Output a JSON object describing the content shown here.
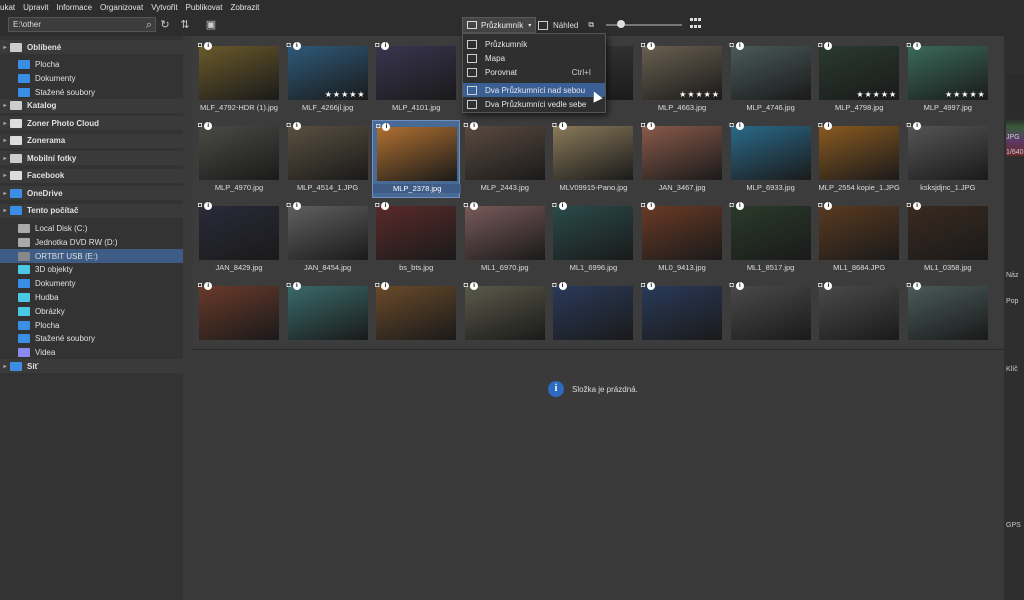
{
  "menubar": [
    "ukat",
    "Upravit",
    "Informace",
    "Organizovat",
    "Vytvořit",
    "Publikovat",
    "Zobrazit"
  ],
  "toolbar": {
    "path_value": "E:\\other",
    "view_label": "Průzkumník",
    "preview_label": "Náhled",
    "zoom_fraction": 0.2
  },
  "sidebar": {
    "items": [
      {
        "label": "Oblíbené",
        "section": true
      },
      {
        "label": "Plocha"
      },
      {
        "label": "Dokumenty"
      },
      {
        "label": "Stažené soubory"
      },
      {
        "label": "Katalog",
        "section": true
      },
      {
        "label": "Zoner Photo Cloud",
        "section": true
      },
      {
        "label": "Zonerama",
        "section": true
      },
      {
        "label": "Mobilní fotky",
        "section": true
      },
      {
        "label": "Facebook",
        "section": true
      },
      {
        "label": "OneDrive",
        "section": true
      },
      {
        "label": "Tento počítač",
        "section": true
      },
      {
        "label": "Local Disk (C:)"
      },
      {
        "label": "Jednotka DVD RW (D:)"
      },
      {
        "label": "ORTBIT USB (E:)",
        "selected": true
      },
      {
        "label": "3D objekty"
      },
      {
        "label": "Dokumenty"
      },
      {
        "label": "Hudba"
      },
      {
        "label": "Obrázky"
      },
      {
        "label": "Plocha"
      },
      {
        "label": "Stažené soubory"
      },
      {
        "label": "Videa"
      },
      {
        "label": "Síť",
        "section": true
      }
    ]
  },
  "dropdown": {
    "items": [
      {
        "label": "Průzkumník",
        "shortcut": ""
      },
      {
        "label": "Mapa",
        "shortcut": ""
      },
      {
        "label": "Porovnat",
        "shortcut": "Ctrl+I"
      },
      {
        "label": "Dva Průzkumníci nad sebou",
        "shortcut": "",
        "highlight": true
      },
      {
        "label": "Dva Průzkumníci vedle sebe",
        "shortcut": ""
      }
    ]
  },
  "files": [
    {
      "name": "MLF_4792-HDR (1).jpg",
      "color": "#6a5a2a",
      "stars": ""
    },
    {
      "name": "MLF_4266jl.jpg",
      "color": "#2e5a7a",
      "stars": "★★★★★"
    },
    {
      "name": "MLP_4101.jpg",
      "color": "#3a3550",
      "stars": ""
    },
    {
      "name": "",
      "color": "#3a3a3a",
      "stars": ""
    },
    {
      "name": "",
      "color": "#3a3a3a",
      "stars": ""
    },
    {
      "name": "MLP_4663.jpg",
      "color": "#6a6050",
      "stars": "★★★★★"
    },
    {
      "name": "MLP_4746.jpg",
      "color": "#4a5a5a",
      "stars": ""
    },
    {
      "name": "MLP_4798.jpg",
      "color": "#2a3a30",
      "stars": "★★★★★"
    },
    {
      "name": "MLP_4997.jpg",
      "color": "#3a6a5a",
      "stars": "★★★★★"
    },
    {
      "name": "MLP_4970.jpg",
      "color": "#4a4a45",
      "stars": ""
    },
    {
      "name": "MLP_4514_1.JPG",
      "color": "#5a5040",
      "stars": ""
    },
    {
      "name": "MLP_2378.jpg",
      "color": "#b07030",
      "stars": "",
      "selected": true
    },
    {
      "name": "MLP_2443.jpg",
      "color": "#5a4a40",
      "stars": ""
    },
    {
      "name": "MLV09915-Pano.jpg",
      "color": "#8a7a5a",
      "stars": ""
    },
    {
      "name": "JAN_3467.jpg",
      "color": "#8a5a4a",
      "stars": ""
    },
    {
      "name": "MLP_6933.jpg",
      "color": "#2a6a8a",
      "stars": ""
    },
    {
      "name": "MLP_2554 kopie_1.JPG",
      "color": "#8a5a20",
      "stars": ""
    },
    {
      "name": "ksksjdjnc_1.JPG",
      "color": "#555555",
      "stars": ""
    },
    {
      "name": "JAN_8429.jpg",
      "color": "#2a2a3a",
      "stars": ""
    },
    {
      "name": "JAN_8454.jpg",
      "color": "#606060",
      "stars": ""
    },
    {
      "name": "bs_bts.jpg",
      "color": "#5a2a2a",
      "stars": ""
    },
    {
      "name": "ML1_6970.jpg",
      "color": "#7a5a5a",
      "stars": ""
    },
    {
      "name": "ML1_6996.jpg",
      "color": "#2a4a4a",
      "stars": ""
    },
    {
      "name": "ML0_9413.jpg",
      "color": "#6a3a25",
      "stars": ""
    },
    {
      "name": "ML1_8517.jpg",
      "color": "#2a3a2a",
      "stars": ""
    },
    {
      "name": "ML1_8684.JPG",
      "color": "#5a3a20",
      "stars": ""
    },
    {
      "name": "ML1_0358.jpg",
      "color": "#3a2a20",
      "stars": ""
    },
    {
      "name": "",
      "color": "#6a3a2a",
      "stars": ""
    },
    {
      "name": "",
      "color": "#3a6a6a",
      "stars": ""
    },
    {
      "name": "",
      "color": "#6a4a2a",
      "stars": ""
    },
    {
      "name": "",
      "color": "#5a5a4a",
      "stars": ""
    },
    {
      "name": "",
      "color": "#2a3a5a",
      "stars": ""
    },
    {
      "name": "",
      "color": "#2a3a5a",
      "stars": ""
    },
    {
      "name": "",
      "color": "#4a4a4a",
      "stars": ""
    },
    {
      "name": "",
      "color": "#4a4a4a",
      "stars": ""
    },
    {
      "name": "",
      "color": "#4a5a5a",
      "stars": ""
    }
  ],
  "empty_message": "Složka je prázdná.",
  "right_panel": {
    "labels": [
      "JPG",
      "1/640",
      "Náz",
      "Pop",
      "Klíč",
      "GPS"
    ]
  }
}
